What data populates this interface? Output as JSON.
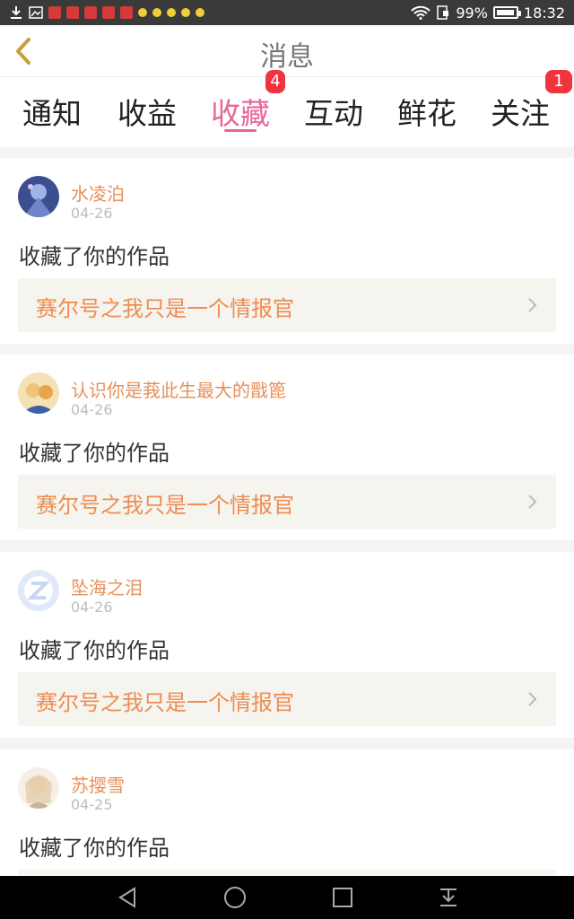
{
  "status_bar": {
    "battery": "99%",
    "time": "18:32"
  },
  "header": {
    "title": "消息"
  },
  "tabs": [
    {
      "label": "通知",
      "badge": null
    },
    {
      "label": "收益",
      "badge": null
    },
    {
      "label": "收藏",
      "badge": "4",
      "active": true
    },
    {
      "label": "互动",
      "badge": null
    },
    {
      "label": "鲜花",
      "badge": null
    },
    {
      "label": "关注",
      "badge": "1"
    }
  ],
  "messages": [
    {
      "user": "水凌泊",
      "date": "04-26",
      "action": "收藏了你的作品",
      "work": "赛尔号之我只是一个情报官"
    },
    {
      "user": "认识你是莪此生最大的戬篦",
      "date": "04-26",
      "action": "收藏了你的作品",
      "work": "赛尔号之我只是一个情报官"
    },
    {
      "user": "坠海之泪",
      "date": "04-26",
      "action": "收藏了你的作品",
      "work": "赛尔号之我只是一个情报官"
    },
    {
      "user": "苏撄雪",
      "date": "04-25",
      "action": "收藏了你的作品",
      "work": ""
    }
  ],
  "colors": {
    "accent": "#e8679a",
    "name": "#e8905a",
    "work_title": "#ef8c52",
    "badge": "#f0343e"
  },
  "icons": [
    "download-icon",
    "image-icon",
    "wifi-icon",
    "sim-icon",
    "battery-icon",
    "back-icon",
    "chevron-right-icon",
    "nav-back-icon",
    "nav-home-icon",
    "nav-recent-icon",
    "nav-menu-icon"
  ]
}
